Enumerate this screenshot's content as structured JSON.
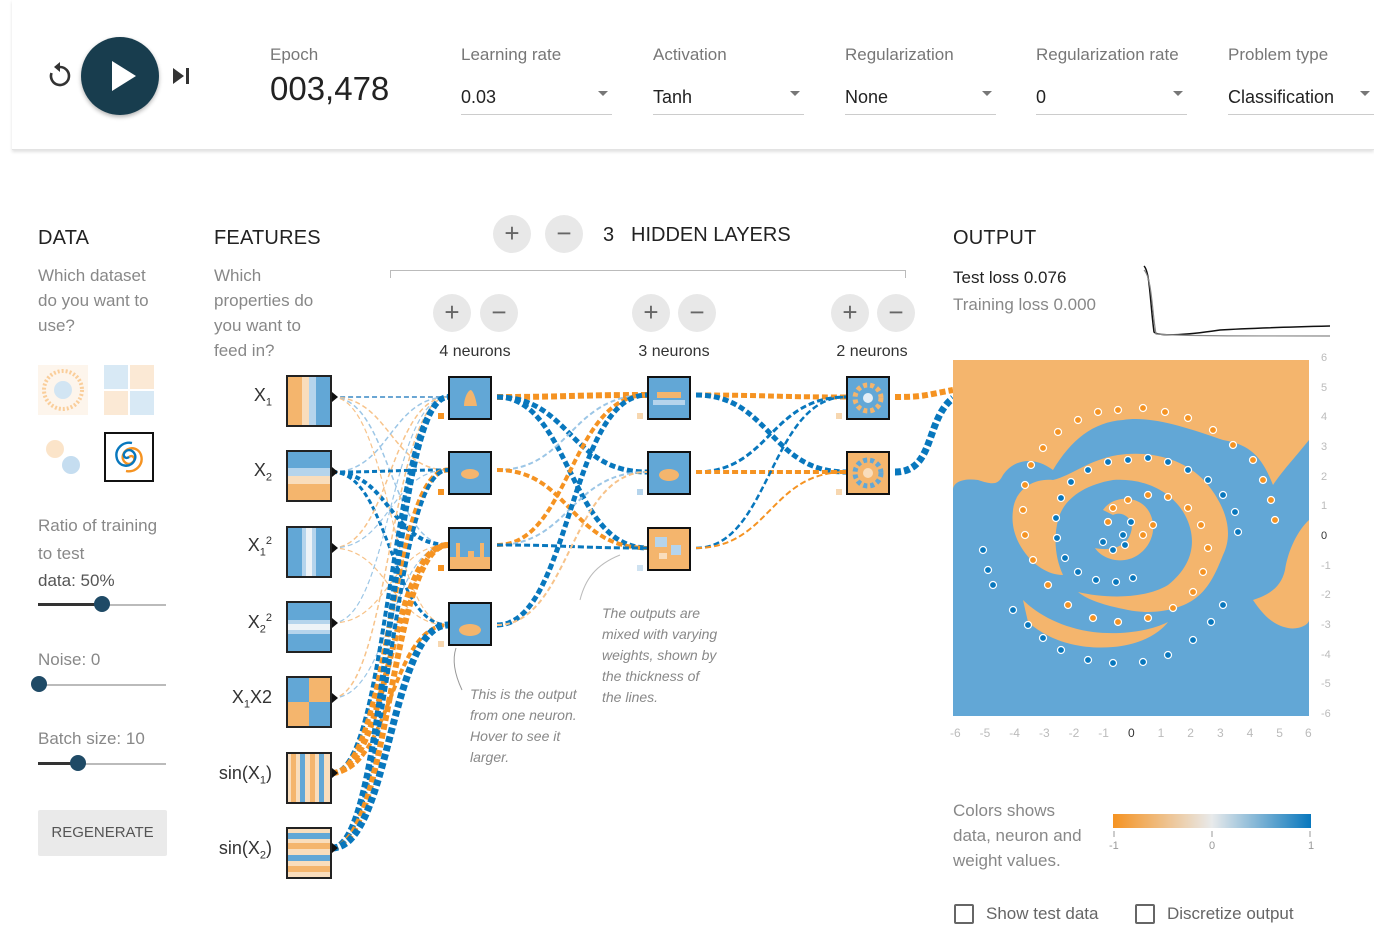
{
  "controls": {
    "epoch_label": "Epoch",
    "epoch_value": "003,478",
    "learning_rate": {
      "label": "Learning rate",
      "value": "0.03"
    },
    "activation": {
      "label": "Activation",
      "value": "Tanh"
    },
    "regularization": {
      "label": "Regularization",
      "value": "None"
    },
    "regularization_rate": {
      "label": "Regularization rate",
      "value": "0"
    },
    "problem_type": {
      "label": "Problem type",
      "value": "Classification"
    }
  },
  "data_panel": {
    "heading": "DATA",
    "question_lines": [
      "Which dataset",
      "do you want to",
      "use?"
    ],
    "ratio_lines": [
      "Ratio of training",
      "to test",
      "data:  50%"
    ],
    "ratio_value": 0.5,
    "noise_label": "Noise:  0",
    "noise_value": 0,
    "batch_label": "Batch size:  10",
    "batch_value": 10,
    "regenerate": "REGENERATE"
  },
  "features_panel": {
    "heading": "FEATURES",
    "question_lines": [
      "Which",
      "properties do",
      "you want to",
      "feed in?"
    ],
    "features": [
      {
        "base": "X",
        "sub": "1",
        "sup": "",
        "suffix": ""
      },
      {
        "base": "X",
        "sub": "2",
        "sup": "",
        "suffix": ""
      },
      {
        "base": "X",
        "sub": "1",
        "sup": "2",
        "suffix": ""
      },
      {
        "base": "X",
        "sub": "2",
        "sup": "2",
        "suffix": ""
      },
      {
        "base": "X",
        "sub": "1",
        "sup": "",
        "suffix": "X2"
      },
      {
        "base": "sin(X",
        "sub": "1",
        "sup": "",
        "suffix": ")"
      },
      {
        "base": "sin(X",
        "sub": "2",
        "sup": "",
        "suffix": ")"
      }
    ]
  },
  "network": {
    "layer_count": "3",
    "layers_title": "HIDDEN LAYERS",
    "layers": [
      {
        "neurons_label": "4 neurons"
      },
      {
        "neurons_label": "3 neurons"
      },
      {
        "neurons_label": "2 neurons"
      }
    ],
    "annotation_neuron": [
      "This is the output",
      "from one neuron.",
      "Hover to see it",
      "larger."
    ],
    "annotation_weights": [
      "The outputs are",
      "mixed with varying",
      "weights, shown by",
      "the thickness of",
      "the lines."
    ]
  },
  "output_panel": {
    "heading": "OUTPUT",
    "test_loss": "Test loss 0.076",
    "training_loss": "Training loss 0.000",
    "y_ticks": [
      "6",
      "5",
      "4",
      "3",
      "2",
      "1",
      "0",
      "-1",
      "-2",
      "-3",
      "-4",
      "-5",
      "-6"
    ],
    "x_ticks": [
      "-6",
      "-5",
      "-4",
      "-3",
      "-2",
      "-1",
      "0",
      "1",
      "2",
      "3",
      "4",
      "5",
      "6"
    ],
    "legend_lines": [
      "Colors shows",
      "data, neuron and",
      "weight values."
    ],
    "legend_ticks": [
      "-1",
      "0",
      "1"
    ],
    "show_test_data": "Show test data",
    "discretize_output": "Discretize output"
  },
  "colors": {
    "orange": "#f59322",
    "blue": "#0877bd",
    "bg_orange": "#f4b56d",
    "bg_blue": "#62a7d6",
    "play": "#183d4e"
  }
}
